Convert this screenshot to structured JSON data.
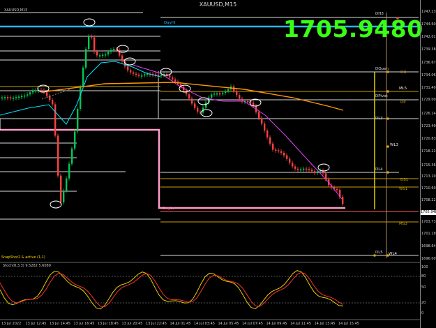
{
  "window": {
    "title": "XAUUSD,M15",
    "subtitle": "XAUUSD,M15"
  },
  "big_price": "1705.9480",
  "price_tag": "1705.948",
  "price_axis": {
    "labels": [
      {
        "text": "1747.230",
        "price": 1747.23
      },
      {
        "text": "1744.600",
        "price": 1744.6
      },
      {
        "text": "1742.010",
        "price": 1742.01
      },
      {
        "text": "1739.380",
        "price": 1739.38
      },
      {
        "text": "1736.670",
        "price": 1736.67
      },
      {
        "text": "1734.060",
        "price": 1734.06
      },
      {
        "text": "1731.400",
        "price": 1731.4
      },
      {
        "text": "1729.000",
        "price": 1729.0
      },
      {
        "text": "1726.140",
        "price": 1726.14
      },
      {
        "text": "1723.490",
        "price": 1723.49
      },
      {
        "text": "1720.830",
        "price": 1720.83
      },
      {
        "text": "1718.220",
        "price": 1718.22
      },
      {
        "text": "1715.360",
        "price": 1715.36
      },
      {
        "text": "1713.100",
        "price": 1713.1
      },
      {
        "text": "1710.600",
        "price": 1710.6
      },
      {
        "text": "1708.220",
        "price": 1708.22
      },
      {
        "text": "1703.730",
        "price": 1703.73
      },
      {
        "text": "1701.180",
        "price": 1701.18
      },
      {
        "text": "1698.640",
        "price": 1698.64
      },
      {
        "text": "1696.000",
        "price": 1696.0
      }
    ]
  },
  "time_axis": [
    "13 Jul 2022",
    "13 Jul 12:45",
    "13 Jul 14:45",
    "13 Jul 16:45",
    "13 Jul 18:45",
    "13 Jul 20:45",
    "13 Jul 22:45",
    "14 Jul 01:45",
    "14 Jul 03:45",
    "14 Jul 05:45",
    "14 Jul 07:45",
    "14 Jul 09:45",
    "14 Jul 11:45",
    "14 Jul 13:45",
    "14 Jul 15:45"
  ],
  "levels": {
    "dayhi": "DayHi",
    "daylo": "DayLo",
    "dh3": "DH3",
    "dopen": "DOpen",
    "dpivot": "DPivot",
    "dl3": "DL3",
    "dl4": "DL4",
    "dl5": "DL5",
    "do": "DO",
    "dp": "DP",
    "ml5": "ML5",
    "wl3": "WL3",
    "ds1": "DS1",
    "ws1": "WS1",
    "ms3": "MS3",
    "wl4": "WL4"
  },
  "snapshot_label": "SnapShot2 & active (1,1)",
  "oscillator": {
    "label": "Stoch(8,3,3) 9.5282 5.6089",
    "axis": [
      "100",
      "80",
      "50",
      "20",
      "0"
    ]
  },
  "colors": {
    "background": "#000000",
    "bull_candle": "#00c853",
    "bear_candle": "#ff4040",
    "dayhi": "#29b6f6",
    "daylo": "#ff6fa8",
    "fast_ma": "#00e5ff",
    "slow_ma": "#ff9800",
    "pink_ma": "#e040fb",
    "big_price": "#39ff14"
  }
}
